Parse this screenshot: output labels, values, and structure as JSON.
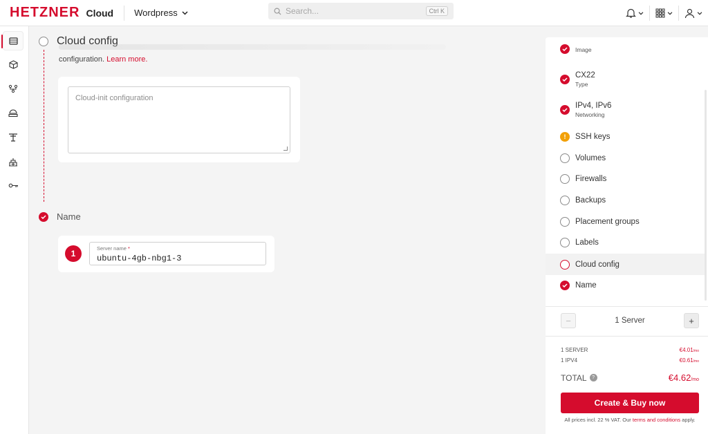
{
  "header": {
    "logo": "HETZNER",
    "product": "Cloud",
    "project": "Wordpress",
    "search_placeholder": "Search...",
    "search_shortcut": "Ctrl K"
  },
  "colors": {
    "accent": "#d50c2d",
    "warning": "#f2a007"
  },
  "rail": {
    "items": [
      {
        "icon": "server-icon",
        "active": true
      },
      {
        "icon": "cube-icon",
        "active": false
      },
      {
        "icon": "network-icon",
        "active": false
      },
      {
        "icon": "storage-icon",
        "active": false
      },
      {
        "icon": "load-balancer-icon",
        "active": false
      },
      {
        "icon": "firewall-icon",
        "active": false
      },
      {
        "icon": "key-icon",
        "active": false
      }
    ]
  },
  "main": {
    "cloud_config": {
      "title": "Cloud config",
      "description": "configuration.",
      "learn_more": "Learn more.",
      "textarea_placeholder": "Cloud-init configuration"
    },
    "name_step": {
      "title": "Name",
      "index": "1",
      "field_label": "Server name",
      "required_mark": "*",
      "field_value": "ubuntu-4gb-nbg1-3"
    }
  },
  "summary": {
    "items": [
      {
        "status": "done",
        "label": "",
        "sublabel": "Image"
      },
      {
        "status": "done",
        "label": "CX22",
        "sublabel": "Type"
      },
      {
        "status": "done",
        "label": "IPv4, IPv6",
        "sublabel": "Networking"
      },
      {
        "status": "warning",
        "label": "SSH keys",
        "sublabel": ""
      },
      {
        "status": "empty",
        "label": "Volumes",
        "sublabel": ""
      },
      {
        "status": "empty",
        "label": "Firewalls",
        "sublabel": ""
      },
      {
        "status": "empty",
        "label": "Backups",
        "sublabel": ""
      },
      {
        "status": "empty",
        "label": "Placement groups",
        "sublabel": ""
      },
      {
        "status": "empty",
        "label": "Labels",
        "sublabel": ""
      },
      {
        "status": "current",
        "label": "Cloud config",
        "sublabel": ""
      },
      {
        "status": "done",
        "label": "Name",
        "sublabel": ""
      }
    ],
    "quantity_label": "1 Server",
    "minus": "−",
    "plus": "+",
    "prices": [
      {
        "label": "1 SERVER",
        "value": "€4.01",
        "unit": "/mo"
      },
      {
        "label": "1 IPV4",
        "value": "€0.61",
        "unit": "/mo"
      }
    ],
    "total_label": "TOTAL",
    "total_help": "?",
    "total_value": "€4.62",
    "total_unit": "/mo",
    "buy_label": "Create & Buy now",
    "vat_prefix": "All prices incl. 22 % VAT. Our ",
    "vat_link": "terms and conditions",
    "vat_suffix": " apply."
  }
}
